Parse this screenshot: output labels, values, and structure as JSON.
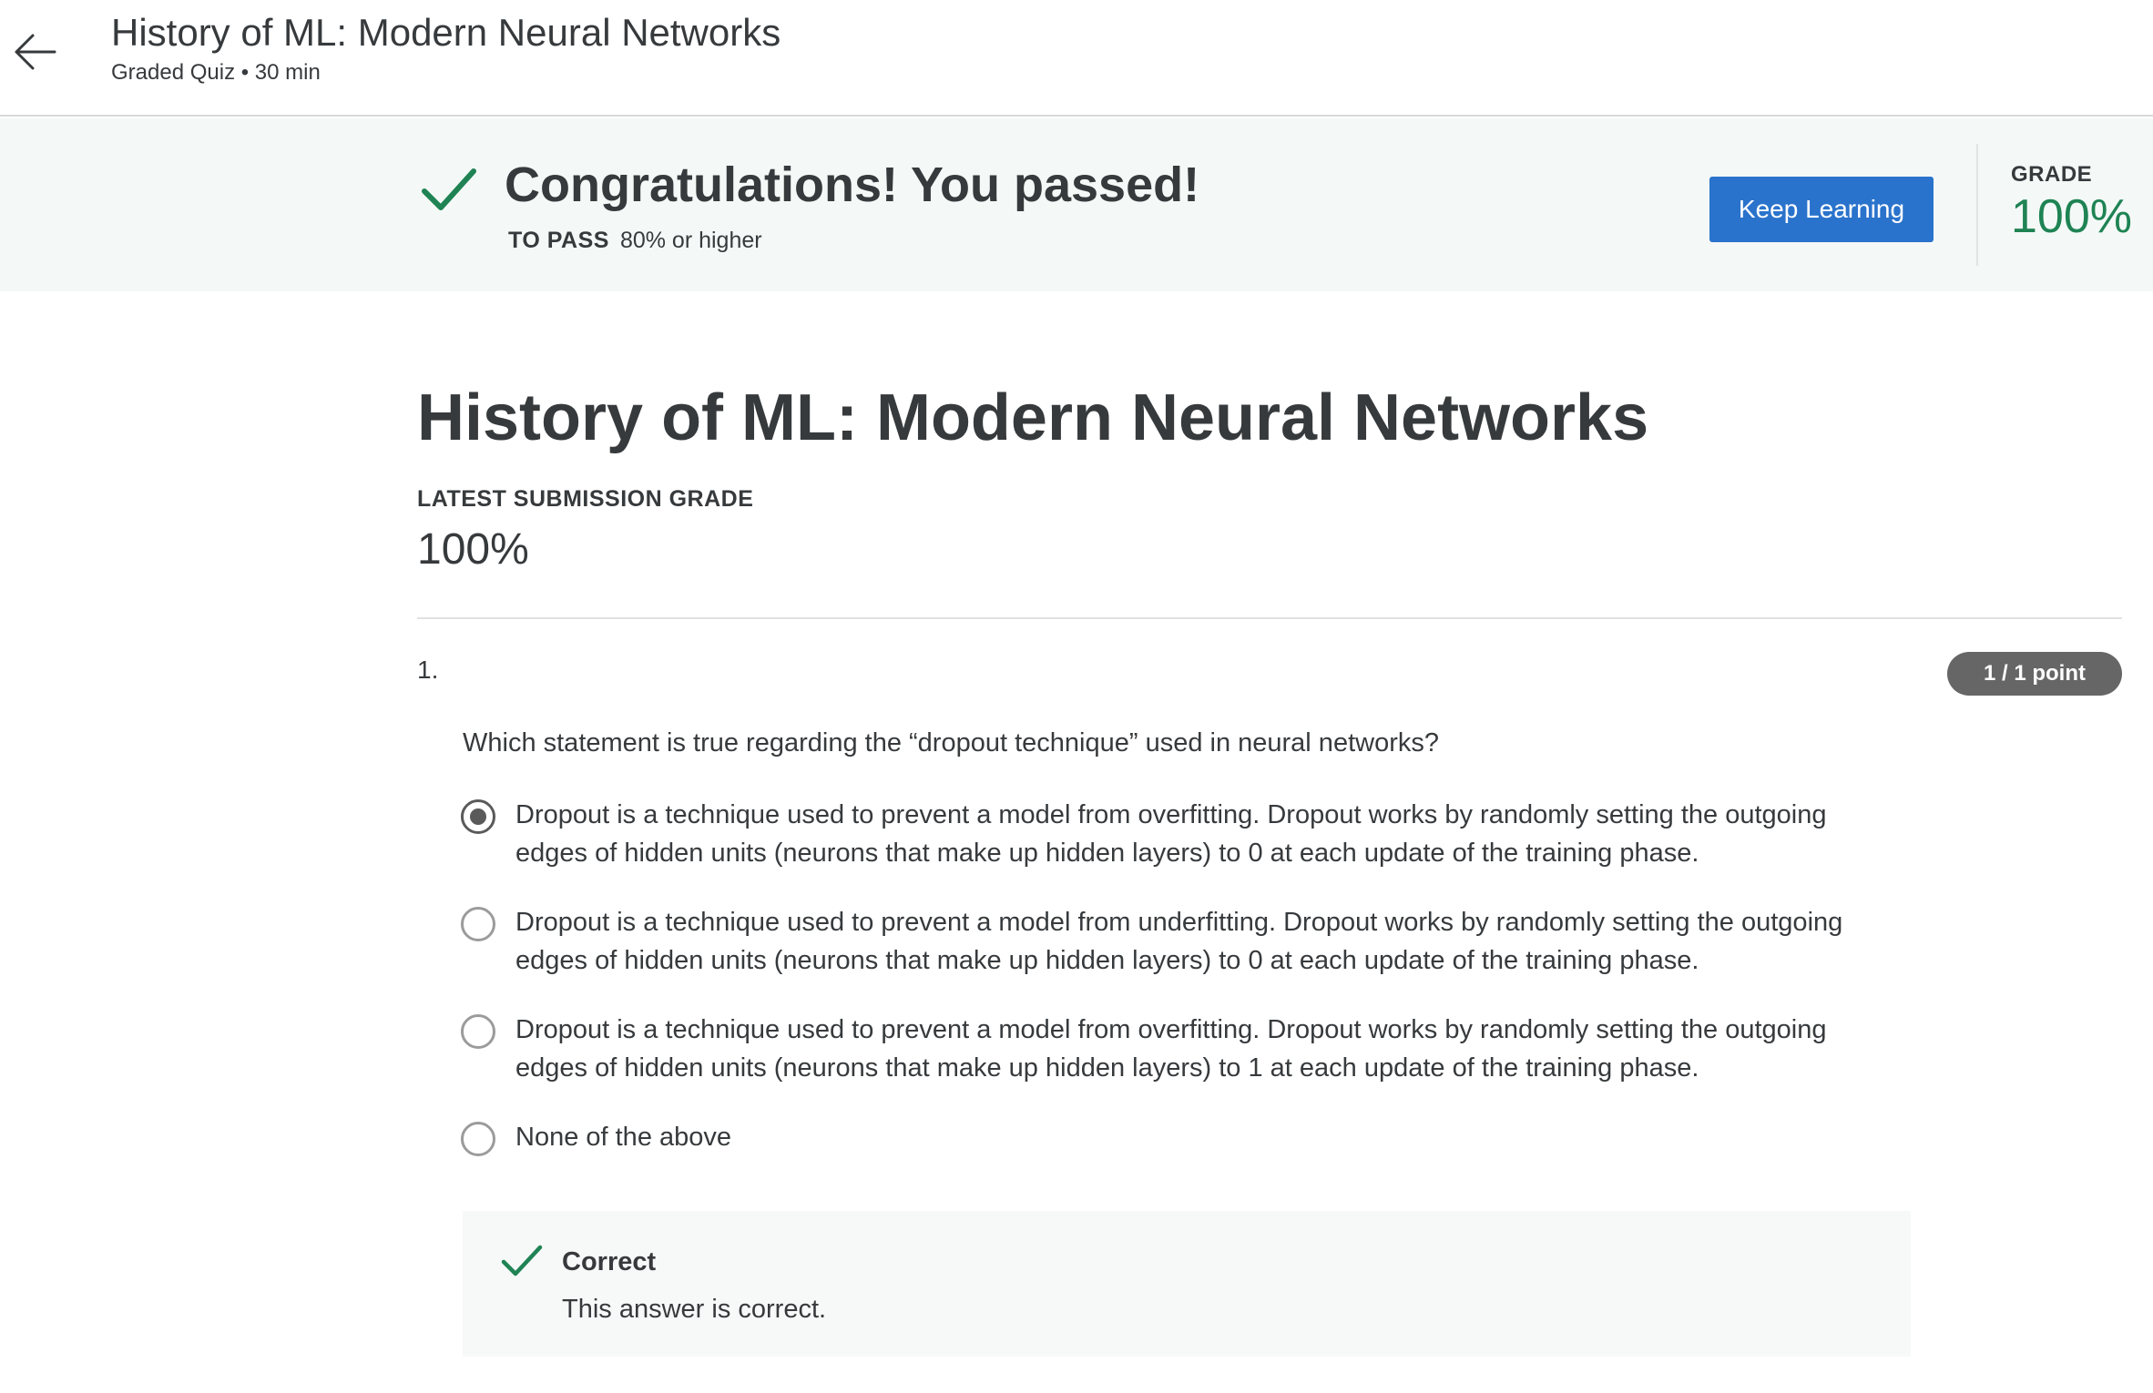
{
  "header": {
    "title": "History of ML: Modern Neural Networks",
    "subtitle": "Graded Quiz • 30 min",
    "back_icon": "arrow-left-icon"
  },
  "banner": {
    "icon": "checkmark-icon",
    "title": "Congratulations! You passed!",
    "to_pass_label": "TO PASS",
    "to_pass_value": "80% or higher",
    "keep_learning_label": "Keep Learning",
    "grade_label": "GRADE",
    "grade_value": "100%",
    "colors": {
      "background": "#f4f9f7",
      "success": "#1f8354",
      "button": "#2a73cc"
    }
  },
  "main": {
    "title": "History of ML: Modern Neural Networks",
    "latest_label": "LATEST SUBMISSION GRADE",
    "latest_value": "100%"
  },
  "question": {
    "number": "1.",
    "points": "1 / 1 point",
    "text": "Which statement is true regarding the “dropout technique” used in neural networks?",
    "options": [
      {
        "lines": [
          "Dropout is a technique used to prevent a model from overfitting. Dropout works by randomly setting the outgoing",
          "edges of hidden units (neurons that make up hidden layers) to 0 at each update of the training phase."
        ],
        "selected": true
      },
      {
        "lines": [
          "Dropout is a technique used to prevent a model from underfitting. Dropout works by randomly setting the outgoing",
          "edges of hidden units (neurons that make up hidden layers) to 0 at each update of the training phase."
        ],
        "selected": false
      },
      {
        "lines": [
          "Dropout is a technique used to prevent a model from overfitting. Dropout works by randomly setting the outgoing",
          "edges of hidden units (neurons that make up hidden layers) to 1 at each update of the training phase."
        ],
        "selected": false
      },
      {
        "lines": [
          "None of the above"
        ],
        "selected": false
      }
    ],
    "feedback": {
      "icon": "checkmark-icon",
      "title": "Correct",
      "text": "This answer is correct."
    }
  }
}
